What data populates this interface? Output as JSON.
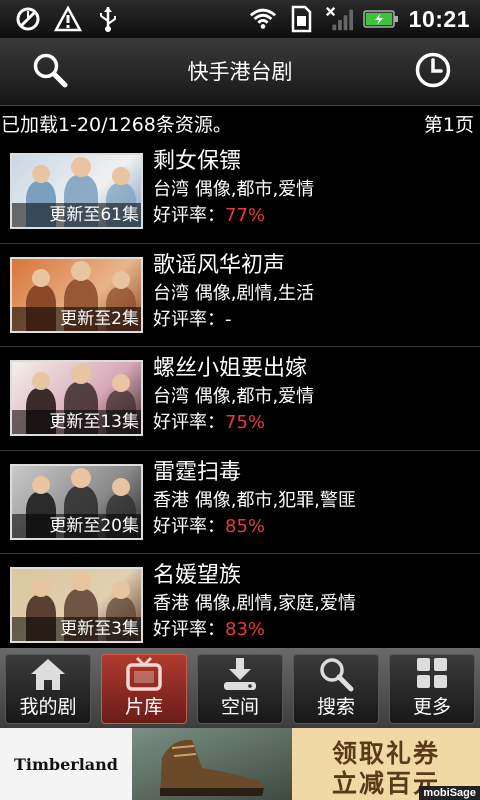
{
  "statusbar": {
    "time": "10:21"
  },
  "header": {
    "title": "快手港台剧"
  },
  "info": {
    "loaded": "已加载1-20/1268条资源。",
    "page": "第1页"
  },
  "items": [
    {
      "title": "剩女保镖",
      "tags": "台湾  偶像,都市,爱情",
      "rating_label": "好评率：",
      "rating": "77%",
      "episodes": "更新至61集",
      "thumb_colors": [
        "#c9d8e4",
        "#7a9fbf",
        "#f0f0f0"
      ]
    },
    {
      "title": "歌谣风华初声",
      "tags": "台湾  偶像,剧情,生活",
      "rating_label": "好评率：",
      "rating": "-",
      "episodes": "更新至2集",
      "thumb_colors": [
        "#d8753a",
        "#8a4a2a",
        "#e9b48a"
      ]
    },
    {
      "title": "螺丝小姐要出嫁",
      "tags": "台湾  偶像,都市,爱情",
      "rating_label": "好评率：",
      "rating": "75%",
      "episodes": "更新至13集",
      "thumb_colors": [
        "#f3f0ea",
        "#3a2a2a",
        "#d8a8b8"
      ]
    },
    {
      "title": "雷霆扫毒",
      "tags": "香港  偶像,都市,犯罪,警匪",
      "rating_label": "好评率：",
      "rating": "85%",
      "episodes": "更新至20集",
      "thumb_colors": [
        "#c9c9c9",
        "#2a2a2a",
        "#8a8a8a"
      ]
    },
    {
      "title": "名媛望族",
      "tags": "香港  偶像,剧情,家庭,爱情",
      "rating_label": "好评率：",
      "rating": "83%",
      "episodes": "更新至3集",
      "thumb_colors": [
        "#d9c7a0",
        "#5a4030",
        "#e2cfb0"
      ]
    }
  ],
  "tabs": [
    {
      "label": "我的剧",
      "icon": "home-icon",
      "active": false
    },
    {
      "label": "片库",
      "icon": "tv-icon",
      "active": true
    },
    {
      "label": "空间",
      "icon": "download-icon",
      "active": false
    },
    {
      "label": "搜索",
      "icon": "search-icon",
      "active": false
    },
    {
      "label": "更多",
      "icon": "grid-icon",
      "active": false
    }
  ],
  "ad": {
    "brand": "Timberland",
    "promo_line1": "领取礼券",
    "promo_line2": "立减百元",
    "network": "mobiSage"
  },
  "colors": {
    "accent_red": "#e63b3b",
    "active_tab": "#b03a2f"
  }
}
